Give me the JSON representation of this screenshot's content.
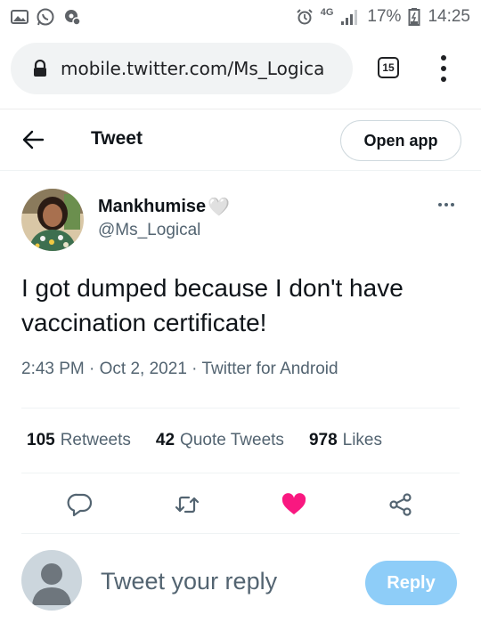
{
  "status_bar": {
    "network": "4G",
    "battery": "17%",
    "time": "14:25"
  },
  "browser": {
    "url": "mobile.twitter.com/Ms_Logica",
    "tab_count": "15"
  },
  "header": {
    "title": "Tweet",
    "open_app_label": "Open app"
  },
  "tweet": {
    "author_name": "Mankhumise",
    "author_emoji": "🤍",
    "author_handle": "@Ms_Logical",
    "text": "I got dumped because I don't have vaccination certificate!",
    "time": "2:43 PM",
    "date": "Oct 2, 2021",
    "source": "Twitter for Android",
    "separator": "·",
    "retweets_count": "105",
    "retweets_label": "Retweets",
    "quotes_count": "42",
    "quotes_label": "Quote Tweets",
    "likes_count": "978",
    "likes_label": "Likes",
    "liked": true
  },
  "reply": {
    "placeholder": "Tweet your reply",
    "button_label": "Reply"
  },
  "colors": {
    "like_active": "#f91880",
    "reply_button": "#8ecdf8",
    "secondary_text": "#536471",
    "action_icon": "#536471"
  }
}
